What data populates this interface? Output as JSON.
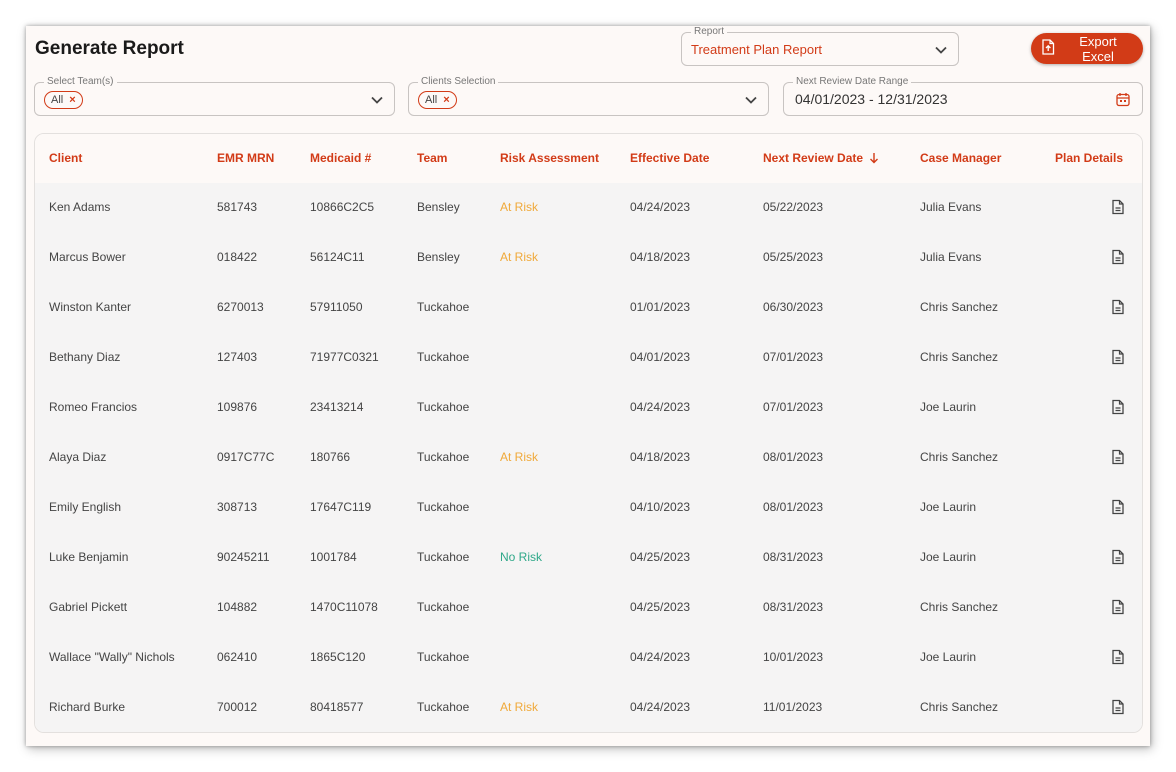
{
  "header": {
    "title": "Generate Report",
    "export_label": "Export Excel"
  },
  "report_select": {
    "legend": "Report",
    "value": "Treatment Plan Report"
  },
  "team_select": {
    "legend": "Select Team(s)",
    "chip": "All"
  },
  "clients_select": {
    "legend": "Clients Selection",
    "chip": "All"
  },
  "date_range": {
    "legend": "Next Review Date Range",
    "value": "04/01/2023 - 12/31/2023"
  },
  "table": {
    "columns": [
      "Client",
      "EMR MRN",
      "Medicaid #",
      "Team",
      "Risk Assessment",
      "Effective Date",
      "Next Review Date",
      "Case Manager",
      "Plan Details"
    ],
    "rows": [
      {
        "client": "Ken Adams",
        "mrn": "581743",
        "medicaid": "10866C2C5",
        "team": "Bensley",
        "risk": "At Risk",
        "effective": "04/24/2023",
        "next": "05/22/2023",
        "manager": "Julia Evans"
      },
      {
        "client": "Marcus Bower",
        "mrn": "018422",
        "medicaid": "56124C11",
        "team": "Bensley",
        "risk": "At Risk",
        "effective": "04/18/2023",
        "next": "05/25/2023",
        "manager": "Julia Evans"
      },
      {
        "client": "Winston Kanter",
        "mrn": "6270013",
        "medicaid": "57911050",
        "team": "Tuckahoe",
        "risk": "",
        "effective": "01/01/2023",
        "next": "06/30/2023",
        "manager": "Chris Sanchez"
      },
      {
        "client": "Bethany Diaz",
        "mrn": "127403",
        "medicaid": "71977C0321",
        "team": "Tuckahoe",
        "risk": "",
        "effective": "04/01/2023",
        "next": "07/01/2023",
        "manager": "Chris Sanchez"
      },
      {
        "client": "Romeo Francios",
        "mrn": "109876",
        "medicaid": "23413214",
        "team": "Tuckahoe",
        "risk": "",
        "effective": "04/24/2023",
        "next": "07/01/2023",
        "manager": "Joe Laurin"
      },
      {
        "client": "Alaya Diaz",
        "mrn": "0917C77C",
        "medicaid": "180766",
        "team": "Tuckahoe",
        "risk": "At Risk",
        "effective": "04/18/2023",
        "next": "08/01/2023",
        "manager": "Chris Sanchez"
      },
      {
        "client": "Emily English",
        "mrn": "308713",
        "medicaid": "17647C119",
        "team": "Tuckahoe",
        "risk": "",
        "effective": "04/10/2023",
        "next": "08/01/2023",
        "manager": "Joe Laurin"
      },
      {
        "client": "Luke Benjamin",
        "mrn": "90245211",
        "medicaid": "1001784",
        "team": "Tuckahoe",
        "risk": "No Risk",
        "effective": "04/25/2023",
        "next": "08/31/2023",
        "manager": "Joe Laurin"
      },
      {
        "client": "Gabriel Pickett",
        "mrn": "104882",
        "medicaid": "1470C11078",
        "team": "Tuckahoe",
        "risk": "",
        "effective": "04/25/2023",
        "next": "08/31/2023",
        "manager": "Chris Sanchez"
      },
      {
        "client": "Wallace \"Wally\" Nichols",
        "mrn": "062410",
        "medicaid": "1865C120",
        "team": "Tuckahoe",
        "risk": "",
        "effective": "04/24/2023",
        "next": "10/01/2023",
        "manager": "Joe Laurin"
      },
      {
        "client": "Richard Burke",
        "mrn": "700012",
        "medicaid": "80418577",
        "team": "Tuckahoe",
        "risk": "At Risk",
        "effective": "04/24/2023",
        "next": "11/01/2023",
        "manager": "Chris Sanchez"
      }
    ]
  },
  "colors": {
    "accent": "#d23b17",
    "at_risk": "#f0a93a",
    "no_risk": "#2fa889"
  }
}
